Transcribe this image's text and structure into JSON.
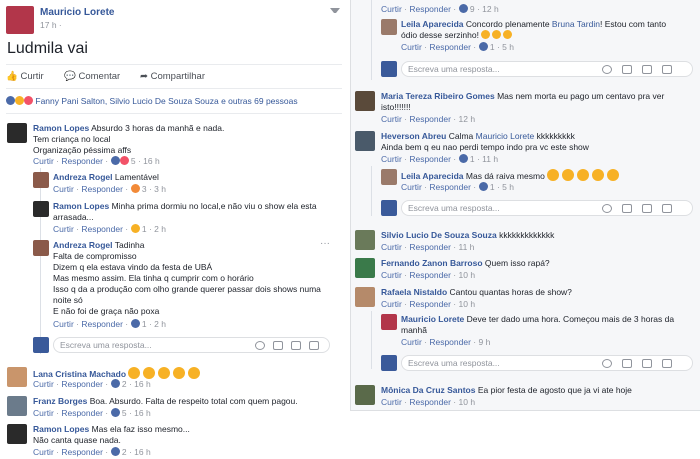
{
  "post": {
    "author": "Mauricio Lorete",
    "time": "17 h",
    "text": "Ludmila vai",
    "actions": {
      "like": "Curtir",
      "comment": "Comentar",
      "share": "Compartilhar"
    },
    "reactions_summary": "Fanny Pani Salton, Silvio Lucio De Souza Souza e outras 69 pessoas"
  },
  "labels": {
    "like": "Curtir",
    "reply": "Responder",
    "reply_placeholder": "Escreva uma resposta..."
  },
  "left_comments": [
    {
      "author": "Ramon Lopes",
      "lines": [
        "Absurdo 3 horas da manhã e nada.",
        "Tem criança no local",
        "Organização péssima affs"
      ],
      "reactions": "5",
      "time": "16 h"
    },
    {
      "author": "Andreza Rogel",
      "lines": [
        "Lamentável"
      ],
      "reactions": "3",
      "time": "3 h"
    },
    {
      "author": "Ramon Lopes",
      "lines": [
        "Minha prima dormiu no local,e não viu o show ela esta",
        "arrasada..."
      ],
      "reactions": "1",
      "time": "2 h"
    },
    {
      "author": "Andreza Rogel",
      "lines": [
        "Tadinha",
        "Falta de compromisso",
        "Dizem q ela estava vindo da festa de UBÁ",
        "Mas mesmo assim. Ela tinha q cumprir com o horário",
        "Isso q da a produção com olho grande querer passar dois shows numa",
        "noite só",
        "E não foi de graça não poxa"
      ],
      "reactions": "1",
      "time": "2 h"
    },
    {
      "author": "Lana Cristina Machado",
      "lines": [
        ""
      ],
      "reactions": "2",
      "time": "16 h"
    },
    {
      "author": "Franz Borges",
      "lines": [
        "Boa. Absurdo. Falta de respeito total com quem pagou."
      ],
      "reactions": "5",
      "time": "16 h"
    },
    {
      "author": "Ramon Lopes",
      "lines": [
        "Mas ela faz isso mesmo...",
        "Não canta quase nada."
      ],
      "reactions": "2",
      "time": "16 h"
    }
  ],
  "right_comments": [
    {
      "author": "",
      "lines": [],
      "reactions": "9",
      "time": "12 h"
    },
    {
      "author": "Leila Aparecida",
      "lines": [
        "Concordo plenamente ",
        "ódio desse serzinho!"
      ],
      "mention": "Bruna Tardin",
      "line0_tail": "! Estou com tanto",
      "reactions": "1",
      "time": "5 h"
    },
    {
      "author": "Maria Tereza Ribeiro Gomes",
      "lines": [
        "Mas nem morta eu pago um centavo pra ver",
        "isto!!!!!!!"
      ],
      "time": "12 h"
    },
    {
      "author": "Heverson Abreu",
      "lines": [
        "Calma ",
        "Ainda bem q eu nao perdi tempo indo pra vc este show"
      ],
      "mention": "Mauricio Lorete",
      "line0_tail": " kkkkkkkkk",
      "reactions": "1",
      "time": "11 h"
    },
    {
      "author": "Leila Aparecida",
      "lines": [
        "Mas dá raiva mesmo"
      ],
      "reactions": "1",
      "time": "5 h"
    },
    {
      "author": "Silvio Lucio De Souza Souza",
      "lines": [
        "kkkkkkkkkkkkk"
      ],
      "time": "11 h"
    },
    {
      "author": "Fernando Zanon Barroso",
      "lines": [
        "Quem isso rapá?"
      ],
      "time": "10 h"
    },
    {
      "author": "Rafaela Nistaldo",
      "lines": [
        "Cantou quantas horas de show?"
      ],
      "time": "10 h"
    },
    {
      "author": "Mauricio Lorete",
      "lines": [
        "Deve ter dado uma hora. Começou mais de 3 horas da",
        "manhã"
      ],
      "time": "9 h"
    },
    {
      "author": "Mônica Da Cruz Santos",
      "lines": [
        "Ea pior festa de agosto que ja vi ate hoje"
      ],
      "time": "10 h"
    }
  ]
}
